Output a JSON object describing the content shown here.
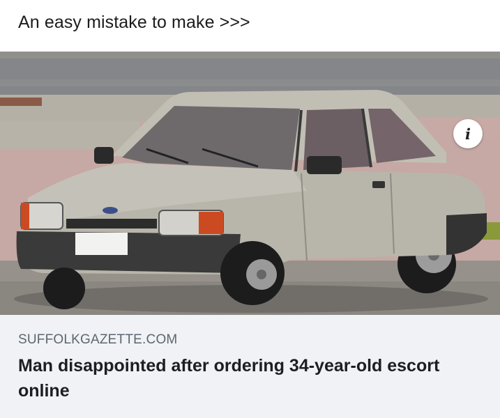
{
  "post": {
    "caption": "An easy mistake to make >>>"
  },
  "link_preview": {
    "image_subject": "car-photo",
    "info_icon": "info-icon",
    "info_glyph": "i",
    "domain": "SUFFOLKGAZETTE.COM",
    "title": "Man disappointed after ordering 34-year-old escort online"
  },
  "colors": {
    "footer_background": "#f0f2f5",
    "domain_text": "#5d6670",
    "title_text": "#1c1e21",
    "car_body": "#b8b6ab"
  }
}
